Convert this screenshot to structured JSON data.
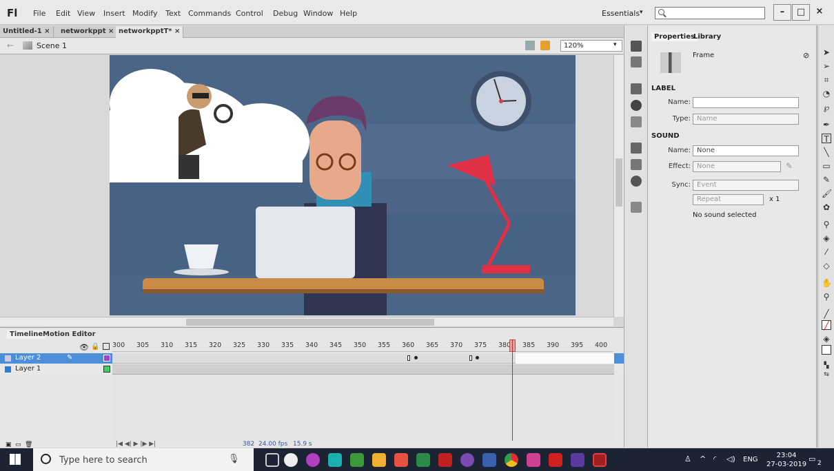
{
  "app": {
    "logo": "Fl",
    "menus": [
      "File",
      "Edit",
      "View",
      "Insert",
      "Modify",
      "Text",
      "Commands",
      "Control",
      "Debug",
      "Window",
      "Help"
    ],
    "workspace": "Essentials",
    "search_placeholder": ""
  },
  "window_controls": [
    "–",
    "□",
    "×"
  ],
  "doc_tabs": [
    {
      "label": "Untitled-1 ×",
      "active": false
    },
    {
      "label": "networkppt ×",
      "active": false
    },
    {
      "label": "networkpptT* ×",
      "active": true
    }
  ],
  "scene": {
    "label": "Scene 1",
    "zoom": "120%"
  },
  "timeline": {
    "tabs": [
      "Timeline",
      "Motion Editor"
    ],
    "ruler": [
      "300",
      "305",
      "310",
      "315",
      "320",
      "325",
      "330",
      "335",
      "340",
      "345",
      "350",
      "355",
      "360",
      "365",
      "370",
      "375",
      "380",
      "385",
      "390",
      "395",
      "400"
    ],
    "layers": [
      {
        "name": "Layer 2",
        "selected": true,
        "color": "#a040e0"
      },
      {
        "name": "Layer 1",
        "selected": false,
        "color": "#40d060"
      }
    ],
    "current_frame": "382",
    "fps": "24.00 fps",
    "time": "15.9 s"
  },
  "properties": {
    "tabs": [
      "Properties",
      "Library"
    ],
    "type": "Frame",
    "label_section": "LABEL",
    "name_label": "Name:",
    "name_value": "",
    "type_label": "Type:",
    "type_value": "Name",
    "sound_section": "SOUND",
    "sound_name_label": "Name:",
    "sound_name_value": "None",
    "effect_label": "Effect:",
    "effect_value": "None",
    "sync_label": "Sync:",
    "sync_value": "Event",
    "repeat_value": "Repeat",
    "repeat_count": "x 1",
    "no_sound": "No sound selected"
  },
  "taskbar": {
    "search_text": "Type here to search",
    "lang": "ENG",
    "time": "23:04",
    "date": "27-03-2019",
    "notification_count": "2"
  }
}
